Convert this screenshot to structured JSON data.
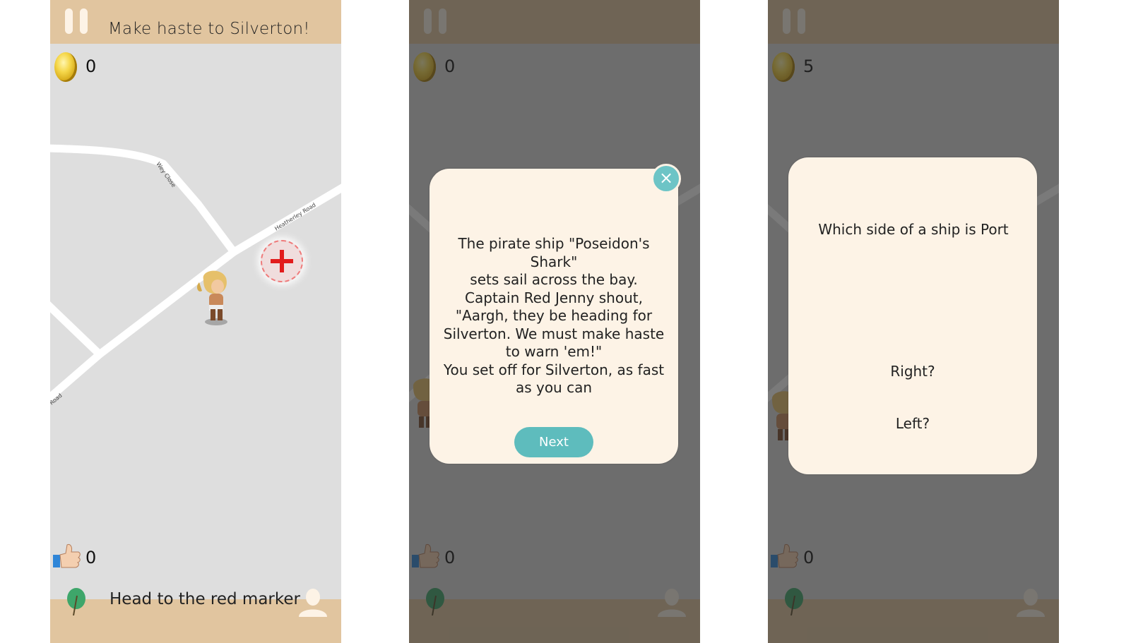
{
  "screens": [
    {
      "header": {
        "title": "Make haste to Silverton!"
      },
      "coins": "0",
      "likes": "0",
      "footer": {
        "hint": "Head to the red marker"
      },
      "map": {
        "street_labels": [
          "Wey Close",
          "Heatherley Road",
          "Road"
        ]
      },
      "dimmed": false
    },
    {
      "header": {
        "title": ""
      },
      "coins": "0",
      "likes": "0",
      "footer": {
        "hint": ""
      },
      "dimmed": true,
      "dialog": {
        "text": "The pirate ship \"Poseidon's Shark\"\nsets sail across the bay.\nCaptain Red Jenny shout,\n\"Aargh, they be heading for\nSilverton. We must make haste\nto warn 'em!\"\nYou set off for Silverton, as fast\nas you can",
        "next_label": "Next",
        "close_icon": "×"
      }
    },
    {
      "header": {
        "title": ""
      },
      "coins": "5",
      "likes": "0",
      "footer": {
        "hint": ""
      },
      "dimmed": true,
      "quiz": {
        "question": "Which side of a ship is Port",
        "answers": [
          "Right?",
          "Left?"
        ]
      }
    }
  ],
  "colors": {
    "bar": "#e1c59f",
    "map_bg": "#dedede",
    "card_bg": "#fdf3e6",
    "accent_teal": "#5ebcbd",
    "marker_red": "#e21c1c"
  }
}
